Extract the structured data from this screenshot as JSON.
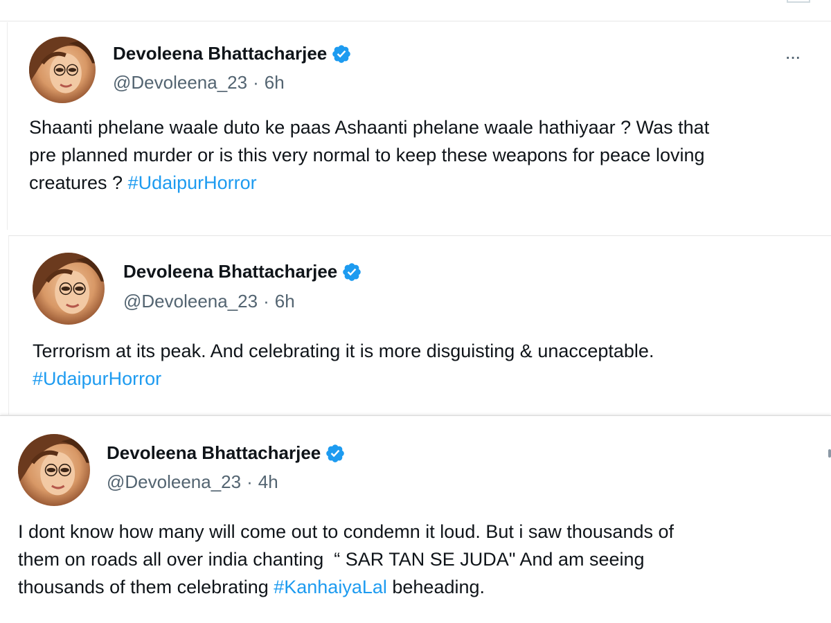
{
  "tweets": [
    {
      "display_name": "Devoleena Bhattacharjee",
      "handle": "@Devoleena_23",
      "separator": "·",
      "time": "6h",
      "more_label": "···",
      "text_lines": [
        "Shaanti phelane waale duto ke paas Ashaanti phelane waale hathiyaar ? Was that",
        "pre planned murder or is this very normal to keep these weapons for peace loving"
      ],
      "text_last_prefix": "creatures ? ",
      "hashtag": "#UdaipurHorror"
    },
    {
      "display_name": "Devoleena Bhattacharjee",
      "handle": "@Devoleena_23",
      "separator": "·",
      "time": "6h",
      "text_lines": [
        "Terrorism at its peak. And celebrating it is more disguisting & unacceptable."
      ],
      "hashtag": "#UdaipurHorror"
    },
    {
      "display_name": "Devoleena Bhattacharjee",
      "handle": "@Devoleena_23",
      "separator": "·",
      "time": "4h",
      "text_lines": [
        "I dont know how many will come out to condemn it loud. But i saw thousands of",
        "them on roads all over india chanting  “ SAR TAN SE JUDA\" And am seeing"
      ],
      "text_last_prefix": "thousands of them celebrating ",
      "hashtag": "#KanhaiyaLal",
      "text_last_suffix": " beheading."
    }
  ],
  "colors": {
    "verified_badge": "#1d9bf0",
    "hashtag": "#1d9bf0",
    "meta_text": "#536471",
    "primary_text": "#0f1419"
  },
  "icons": {
    "verified": "verified-badge-icon",
    "more": "more-options-icon",
    "avatar": "profile-avatar"
  }
}
